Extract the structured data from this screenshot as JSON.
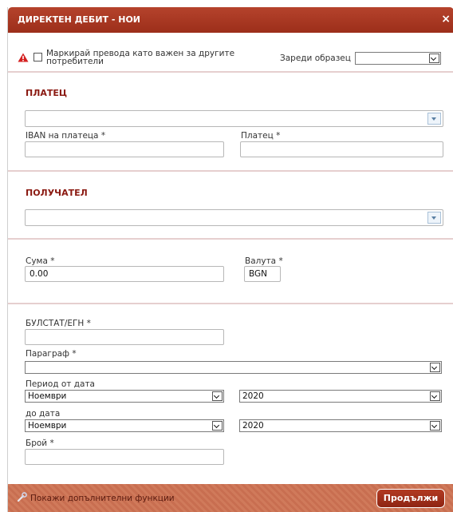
{
  "dialog": {
    "title": "ДИРЕКТЕН ДЕБИТ - НОИ",
    "close_glyph": "×"
  },
  "top": {
    "mark_label_line1": "Маркирай превода като важен за другите",
    "mark_label_line2": "потребители",
    "load_template_label": "Зареди образец",
    "template_value": ""
  },
  "payer": {
    "section_title": "ПЛАТЕЦ",
    "selector_value": "",
    "iban_label": "IBAN на платеца *",
    "iban_value": "",
    "name_label": "Платец *",
    "name_value": ""
  },
  "recipient": {
    "section_title": "ПОЛУЧАТЕЛ",
    "selector_value": ""
  },
  "amount": {
    "amount_label": "Сума *",
    "amount_value": "0.00",
    "currency_label": "Валута *",
    "currency_value": "BGN"
  },
  "details": {
    "bulstat_label": "БУЛСТАТ/ЕГН *",
    "bulstat_value": "",
    "paragraph_label": "Параграф *",
    "paragraph_value": "",
    "period_from_label": "Период от дата",
    "from_month": "Ноември",
    "from_year": "2020",
    "to_label": "до дата",
    "to_month": "Ноември",
    "to_year": "2020",
    "count_label": "Брой *",
    "count_value": ""
  },
  "footer": {
    "more_functions_label": "Покажи допълнителни функции",
    "continue_label": "Продължи"
  },
  "colors": {
    "header": "#a83822",
    "section_title": "#8b1a12",
    "footer": "#cc7656",
    "warning": "#d42020"
  },
  "icons": [
    "warning-icon",
    "close-icon",
    "chevron-down-icon",
    "wrench-icon"
  ]
}
